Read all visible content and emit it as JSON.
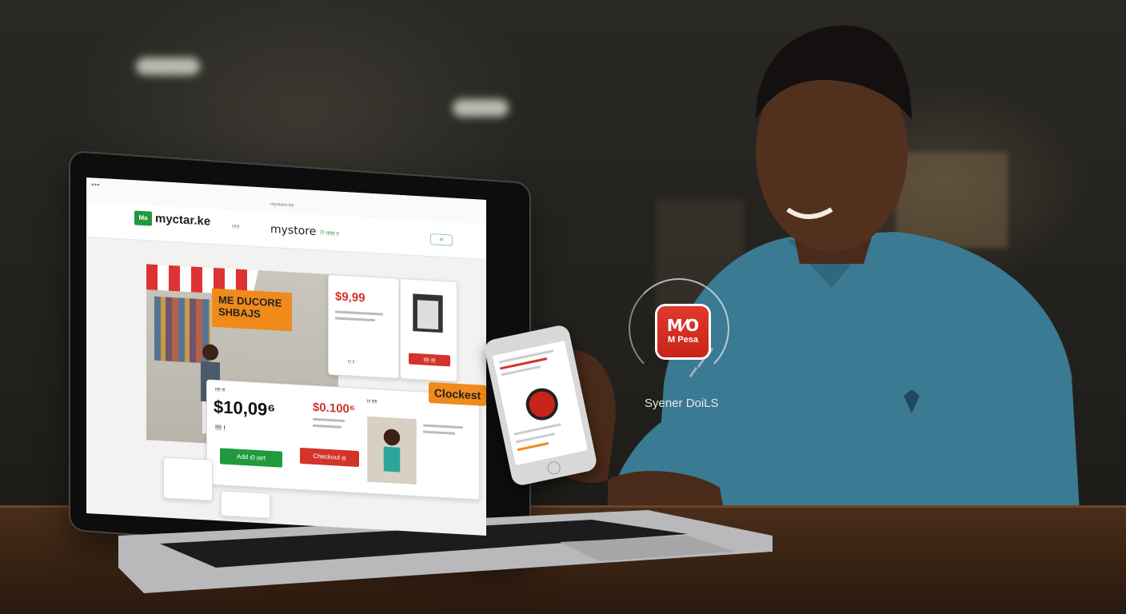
{
  "browser": {
    "title_bar": "mystore.ke"
  },
  "site": {
    "logo_badge": "Ma",
    "logo_text": "myctar.ke",
    "nav_center": "mystore",
    "nav_link_1": "ᴉᴉᴉᴉᴉᴉᴉ",
    "nav_green": "⊙ ᴉᴉᴉᴉᴉᴉᴉ ᴉᴉ",
    "cart": "ᴉᴉᴉ"
  },
  "hero": {
    "badge_line1": "ME DUCORE",
    "badge_line2": "SHBAJS"
  },
  "product_card_1": {
    "price": "$9,99",
    "label": "ᴉᴉᴉ ᴉᴉ"
  },
  "product_card_2": {
    "button": "ᴉᴉᴉᴉ ᴉᴉᴉ"
  },
  "checkout_panel": {
    "header": "ᴉᴉᴉᴉᴉ ᴉᴉᴉ",
    "big_price": "$10,09⁶",
    "sub": "ᴉᴉᴉᴉ ᴉ",
    "red_price": "$0.100⁶",
    "add_button": "Add ᴉ0 ᴉart",
    "checkout_red": "Checkout ᴉᴉᴉ",
    "side_header": "ᴉᴉᴉ ᴉᴉᴉᴉᴉ",
    "checkout_orange": "Clockest"
  },
  "mpesa": {
    "logo_line1": "M⁄O",
    "logo_line2": "M Pesa",
    "caption": "Syener DoiLS"
  },
  "colors": {
    "brand_green": "#1f9a3c",
    "accent_red": "#d2342a",
    "accent_orange": "#f08a1a",
    "mpesa_red": "#d52b20"
  }
}
